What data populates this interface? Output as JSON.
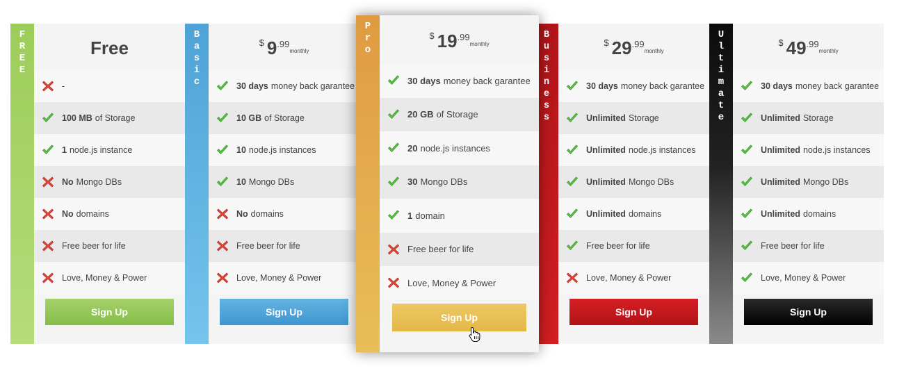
{
  "plans": [
    {
      "id": "free",
      "side_label": "F\nR\nE\nE",
      "title": "Free",
      "side_color": "#9ccd5a",
      "button_color": "#8fc450",
      "features": [
        {
          "status": "no",
          "bold": "",
          "text": "-"
        },
        {
          "status": "yes",
          "bold": "100 MB",
          "text": "of Storage"
        },
        {
          "status": "yes",
          "bold": "1",
          "text": "node.js instance"
        },
        {
          "status": "no",
          "bold": "No",
          "text": "Mongo DBs"
        },
        {
          "status": "no",
          "bold": "No",
          "text": "domains"
        },
        {
          "status": "no",
          "bold": "",
          "text": "Free beer for life"
        },
        {
          "status": "no",
          "bold": "",
          "text": "Love, Money & Power"
        }
      ],
      "button_label": "Sign Up"
    },
    {
      "id": "basic",
      "side_label": "B\na\ns\ni\nc",
      "currency": "$",
      "price_int": "9",
      "price_dec": ".99",
      "period": "monthly",
      "side_color": "#4ea3d6",
      "button_color": "#4a9fd5",
      "features": [
        {
          "status": "yes",
          "bold": "30 days",
          "text": "money back garantee"
        },
        {
          "status": "yes",
          "bold": "10 GB",
          "text": "of Storage"
        },
        {
          "status": "yes",
          "bold": "10",
          "text": "node.js instances"
        },
        {
          "status": "yes",
          "bold": "10",
          "text": "Mongo DBs"
        },
        {
          "status": "no",
          "bold": "No",
          "text": "domains"
        },
        {
          "status": "no",
          "bold": "",
          "text": "Free beer for life"
        },
        {
          "status": "no",
          "bold": "",
          "text": "Love, Money & Power"
        }
      ],
      "button_label": "Sign Up"
    },
    {
      "id": "pro",
      "side_label": "P\nr\no",
      "currency": "$",
      "price_int": "19",
      "price_dec": ".99",
      "period": "monthly",
      "side_color": "#e5a446",
      "button_color": "#e8c156",
      "features": [
        {
          "status": "yes",
          "bold": "30 days",
          "text": "money back garantee"
        },
        {
          "status": "yes",
          "bold": "20 GB",
          "text": "of Storage"
        },
        {
          "status": "yes",
          "bold": "20",
          "text": "node.js instances"
        },
        {
          "status": "yes",
          "bold": "30",
          "text": "Mongo DBs"
        },
        {
          "status": "yes",
          "bold": "1",
          "text": "domain"
        },
        {
          "status": "no",
          "bold": "",
          "text": "Free beer for life"
        },
        {
          "status": "no",
          "bold": "",
          "text": "Love, Money & Power"
        }
      ],
      "button_label": "Sign Up"
    },
    {
      "id": "business",
      "side_label": "B\nu\ns\ni\nn\ne\ns\ns",
      "currency": "$",
      "price_int": "29",
      "price_dec": ".99",
      "period": "monthly",
      "side_color": "#c0191c",
      "button_color": "#c8171b",
      "features": [
        {
          "status": "yes",
          "bold": "30 days",
          "text": "money back garantee"
        },
        {
          "status": "yes",
          "bold": "Unlimited",
          "text": "Storage"
        },
        {
          "status": "yes",
          "bold": "Unlimited",
          "text": "node.js instances"
        },
        {
          "status": "yes",
          "bold": "Unlimited",
          "text": "Mongo DBs"
        },
        {
          "status": "yes",
          "bold": "Unlimited",
          "text": "domains"
        },
        {
          "status": "yes",
          "bold": "",
          "text": "Free beer for life"
        },
        {
          "status": "no",
          "bold": "",
          "text": "Love, Money & Power"
        }
      ],
      "button_label": "Sign Up"
    },
    {
      "id": "ultimate",
      "side_label": "U\nl\nt\ni\nm\na\nt\ne",
      "currency": "$",
      "price_int": "49",
      "price_dec": ".99",
      "period": "monthly",
      "side_color": "#111111",
      "button_color": "#1a1a1a",
      "features": [
        {
          "status": "yes",
          "bold": "30 days",
          "text": "money back garantee"
        },
        {
          "status": "yes",
          "bold": "Unlimited",
          "text": "Storage"
        },
        {
          "status": "yes",
          "bold": "Unlimited",
          "text": "node.js instances"
        },
        {
          "status": "yes",
          "bold": "Unlimited",
          "text": "Mongo DBs"
        },
        {
          "status": "yes",
          "bold": "Unlimited",
          "text": "domains"
        },
        {
          "status": "yes",
          "bold": "",
          "text": "Free beer for life"
        },
        {
          "status": "yes",
          "bold": "",
          "text": "Love, Money & Power"
        }
      ],
      "button_label": "Sign Up"
    }
  ],
  "icons": {
    "yes": "check-icon",
    "no": "cross-icon",
    "cursor": "hand-pointer-icon"
  }
}
